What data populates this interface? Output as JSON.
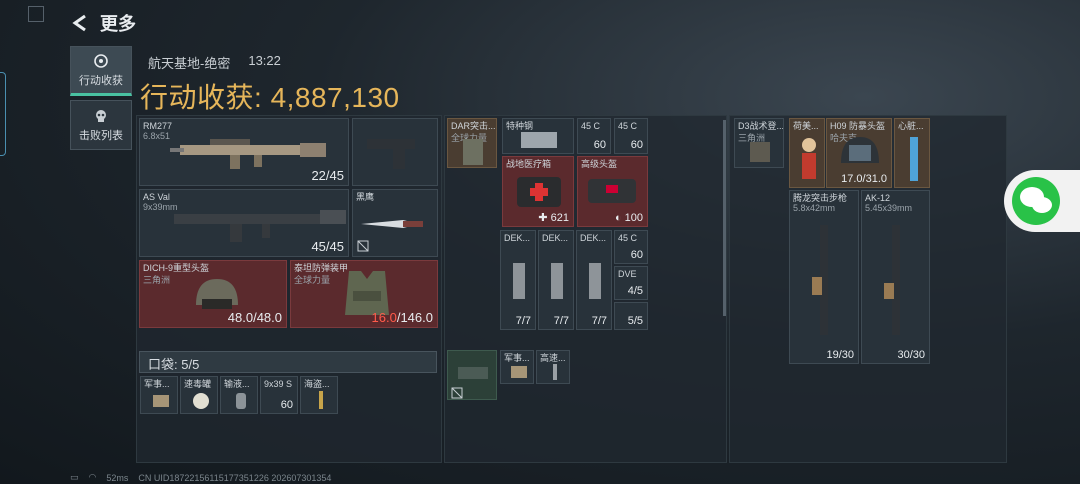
{
  "header": {
    "back_label": "更多"
  },
  "tabs": [
    {
      "label": "行动收获",
      "active": true
    },
    {
      "label": "击败列表",
      "active": false
    }
  ],
  "match": {
    "map": "航天基地-绝密",
    "time": "13:22",
    "total_label": "行动收获:",
    "total_value": "4,887,130"
  },
  "gear": {
    "rm277": {
      "name": "RM277",
      "caliber": "6.8x51",
      "ammo": "22/45"
    },
    "asval": {
      "name": "AS Val",
      "caliber": "9x39mm",
      "ammo": "45/45"
    },
    "knife": {
      "name": "黑鹰"
    },
    "helmet": {
      "name": "DICH-9重型头盔",
      "sub": "三角洲",
      "durability": "48.0/48.0"
    },
    "armor": {
      "name": "泰坦防弹装甲",
      "sub": "全球力量",
      "dur_current": "16.0",
      "dur_max": "/146.0"
    }
  },
  "pocket": {
    "label": "口袋:",
    "count": "5/5",
    "items": [
      "军事...",
      "速毒罐",
      "输液...",
      "9x39 S",
      "海盗..."
    ],
    "ammo_count": "60"
  },
  "backpack": {
    "rig_name": "DAR突击...",
    "rig_sub": "全球力量",
    "steel": "特种钢",
    "ammo1": {
      "name": "45 C",
      "count": "60"
    },
    "ammo2": {
      "name": "45 C",
      "count": "60"
    },
    "medkit": {
      "name": "战地医疗箱",
      "count": "621"
    },
    "helmetkit": {
      "name": "高级头盔",
      "count": "100"
    },
    "dek1": {
      "name": "DEK...",
      "count": "7/7"
    },
    "dek2": {
      "name": "DEK...",
      "count": "7/7"
    },
    "dek3": {
      "name": "DEK...",
      "count": "7/7"
    },
    "ammo3": {
      "name": "45 C",
      "count": "60"
    },
    "dve": {
      "name": "DVE",
      "count": "4/5"
    },
    "last": {
      "count": "5/5"
    },
    "small1": "军事...",
    "small2": "高速..."
  },
  "loot": {
    "first": {
      "name": "D3战术登...",
      "sub": "三角洲"
    },
    "figurine": "荷美...",
    "h09": {
      "name": "H09 防暴头盔",
      "sub": "哈夫克",
      "durability": "17.0/31.0"
    },
    "heart": "心脏...",
    "rifle1": {
      "name": "腾龙突击步枪",
      "caliber": "5.8x42mm",
      "ammo": "19/30"
    },
    "rifle2": {
      "name": "AK-12",
      "caliber": "5.45x39mm",
      "ammo": "30/30"
    }
  },
  "status": {
    "ping": "52ms",
    "uid": "CN UID18722156115177351226 202607301354"
  },
  "colors": {
    "gold": "#e6b65a",
    "red_slot": "#5b2a2d",
    "accent": "#49c2a2",
    "wechat": "#29c248"
  }
}
